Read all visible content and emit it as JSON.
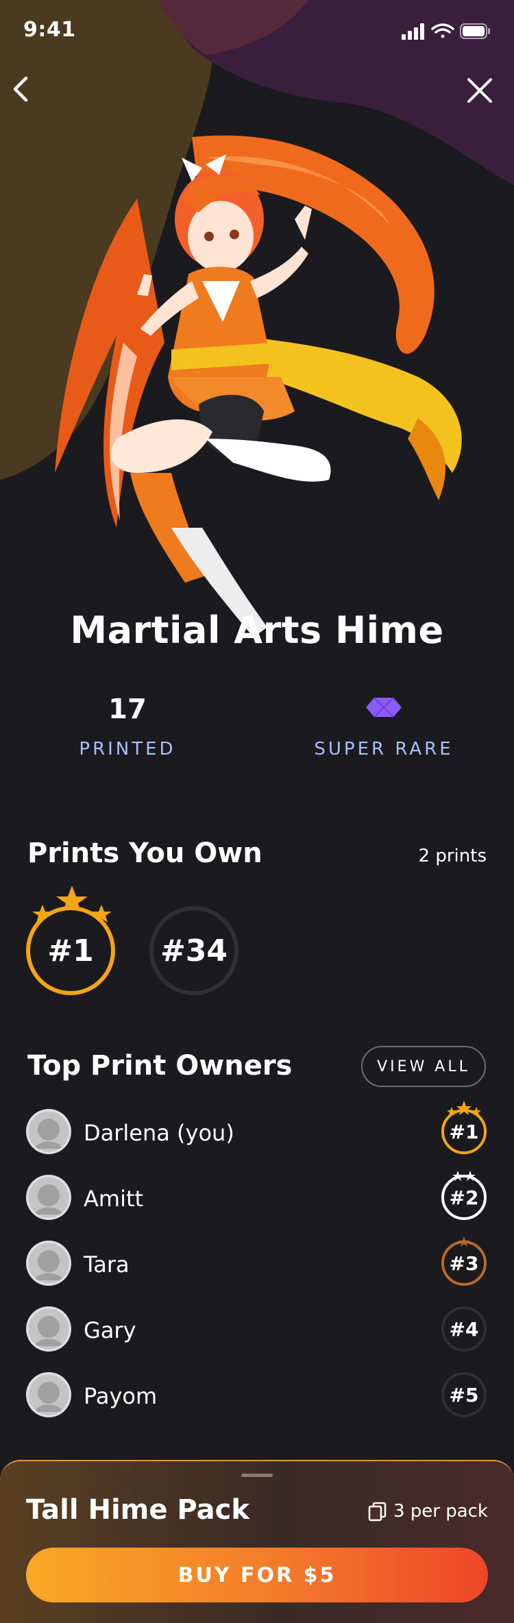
{
  "status_bar": {
    "time": "9:41"
  },
  "card": {
    "name": "Martial Arts Hime",
    "printed_count": "17",
    "printed_label": "PRINTED",
    "rarity_label": "SUPER RARE",
    "rarity_color": "#8b5cf6"
  },
  "prints_you_own": {
    "title": "Prints You Own",
    "count_label": "2 prints",
    "prints": [
      "#1",
      "#34"
    ]
  },
  "top_owners": {
    "title": "Top Print Owners",
    "view_all_label": "VIEW ALL",
    "owners": [
      {
        "name": "Darlena (you)",
        "rank": "#1",
        "tier": "gold"
      },
      {
        "name": "Amitt",
        "rank": "#2",
        "tier": "silver"
      },
      {
        "name": "Tara",
        "rank": "#3",
        "tier": "bronze"
      },
      {
        "name": "Gary",
        "rank": "#4",
        "tier": "none"
      },
      {
        "name": "Payom",
        "rank": "#5",
        "tier": "none"
      }
    ]
  },
  "pack": {
    "title": "Tall Hime Pack",
    "per_pack": "3 per pack",
    "buy_label": "BUY FOR $5"
  },
  "colors": {
    "background": "#1b1a1f",
    "gold": "#f2a516",
    "silver": "#ffffff",
    "bronze": "#b86a2a",
    "accent_label": "#a7c0ff"
  }
}
